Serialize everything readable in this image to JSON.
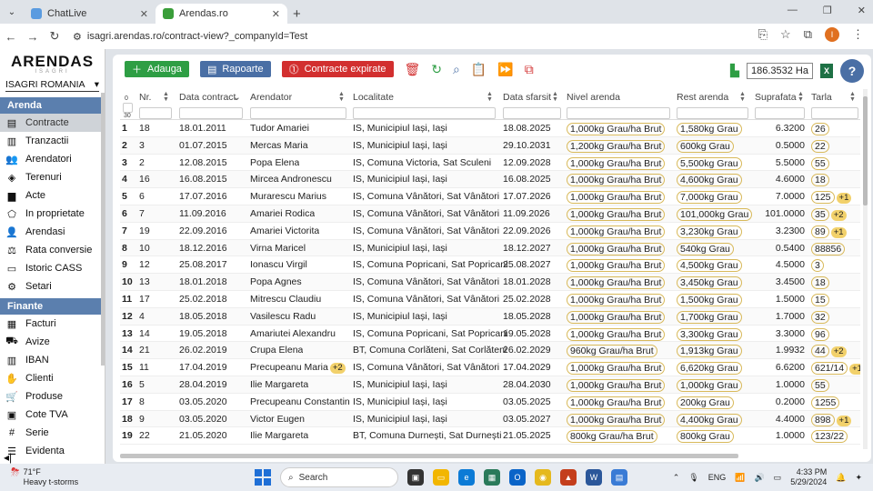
{
  "browser": {
    "tabs": [
      {
        "title": "ChatLive",
        "active": false
      },
      {
        "title": "Arendas.ro",
        "active": true
      }
    ],
    "url": "isagri.arendas.ro/contract-view?_companyId=Test"
  },
  "sidebar": {
    "logo": "ARENDAS",
    "logo_sub": "ISAGRI",
    "company": "ISAGRI ROMANIA",
    "section_arenda": "Arenda",
    "arenda_items": [
      {
        "label": "Contracte",
        "icon": "document-icon"
      },
      {
        "label": "Tranzactii",
        "icon": "book-icon"
      },
      {
        "label": "Arendatori",
        "icon": "people-icon"
      },
      {
        "label": "Terenuri",
        "icon": "layers-icon"
      },
      {
        "label": "Acte",
        "icon": "file-icon"
      },
      {
        "label": "In proprietate",
        "icon": "polygon-icon"
      },
      {
        "label": "Arendasi",
        "icon": "person-icon"
      },
      {
        "label": "Rata conversie",
        "icon": "scale-icon"
      },
      {
        "label": "Istoric CASS",
        "icon": "card-icon"
      },
      {
        "label": "Setari",
        "icon": "gear-icon"
      }
    ],
    "section_finante": "Finante",
    "finante_items": [
      {
        "label": "Facturi",
        "icon": "invoice-icon"
      },
      {
        "label": "Avize",
        "icon": "truck-icon"
      },
      {
        "label": "IBAN",
        "icon": "bank-icon"
      },
      {
        "label": "Clienti",
        "icon": "handshake-icon"
      },
      {
        "label": "Produse",
        "icon": "cart-icon"
      },
      {
        "label": "Cote TVA",
        "icon": "bus-icon"
      },
      {
        "label": "Serie",
        "icon": "hash-icon"
      },
      {
        "label": "Evidenta",
        "icon": "list-icon"
      }
    ]
  },
  "toolbar": {
    "add_label": "Adauga",
    "reports_label": "Rapoarte",
    "expired_label": "Contracte expirate",
    "area_value": "186.3532 Ha"
  },
  "table": {
    "columns": {
      "nr": "Nr.",
      "data_contract": "Data contract",
      "arendator": "Arendator",
      "localitate": "Localitate",
      "data_sfarsit": "Data sfarsit",
      "nivel_arenda": "Nivel arenda",
      "rest_arenda": "Rest arenda",
      "suprafata": "Suprafata",
      "tarla": "Tarla"
    },
    "count_top": "0",
    "count_bottom": "30",
    "rows": [
      {
        "idx": "1",
        "nr": "18",
        "date": "18.01.2011",
        "arendator": "Tudor Amariei",
        "extra_a": "",
        "loc": "IS, Municipiul Iași, Iași",
        "end": "18.08.2025",
        "nivel": "1,000kg Grau/ha Brut",
        "rest": "1,580kg Grau",
        "supr": "6.3200",
        "tarla": "26",
        "extra_t": ""
      },
      {
        "idx": "2",
        "nr": "3",
        "date": "01.07.2015",
        "arendator": "Mercas Maria",
        "extra_a": "",
        "loc": "IS, Municipiul Iași, Iași",
        "end": "29.10.2031",
        "nivel": "1,200kg Grau/ha Brut",
        "rest": "600kg Grau",
        "supr": "0.5000",
        "tarla": "22",
        "extra_t": ""
      },
      {
        "idx": "3",
        "nr": "2",
        "date": "12.08.2015",
        "arendator": "Popa Elena",
        "extra_a": "",
        "loc": "IS, Comuna Victoria, Sat Sculeni",
        "end": "12.09.2028",
        "nivel": "1,000kg Grau/ha Brut",
        "rest": "5,500kg Grau",
        "supr": "5.5000",
        "tarla": "55",
        "extra_t": ""
      },
      {
        "idx": "4",
        "nr": "16",
        "date": "16.08.2015",
        "arendator": "Mircea Andronescu",
        "extra_a": "",
        "loc": "IS, Municipiul Iași, Iași",
        "end": "16.08.2025",
        "nivel": "1,000kg Grau/ha Brut",
        "rest": "4,600kg Grau",
        "supr": "4.6000",
        "tarla": "18",
        "extra_t": ""
      },
      {
        "idx": "5",
        "nr": "6",
        "date": "17.07.2016",
        "arendator": "Murarescu Marius",
        "extra_a": "",
        "loc": "IS, Comuna Vânători, Sat Vânători",
        "end": "17.07.2026",
        "nivel": "1,000kg Grau/ha Brut",
        "rest": "7,000kg Grau",
        "supr": "7.0000",
        "tarla": "125",
        "extra_t": "+1"
      },
      {
        "idx": "6",
        "nr": "7",
        "date": "11.09.2016",
        "arendator": "Amariei Rodica",
        "extra_a": "",
        "loc": "IS, Comuna Vânători, Sat Vânători",
        "end": "11.09.2026",
        "nivel": "1,000kg Grau/ha Brut",
        "rest": "101,000kg Grau",
        "supr": "101.0000",
        "tarla": "35",
        "extra_t": "+2"
      },
      {
        "idx": "7",
        "nr": "19",
        "date": "22.09.2016",
        "arendator": "Amariei Victorita",
        "extra_a": "",
        "loc": "IS, Comuna Vânători, Sat Vânători",
        "end": "22.09.2026",
        "nivel": "1,000kg Grau/ha Brut",
        "rest": "3,230kg Grau",
        "supr": "3.2300",
        "tarla": "89",
        "extra_t": "+1"
      },
      {
        "idx": "8",
        "nr": "10",
        "date": "18.12.2016",
        "arendator": "Virna Maricel",
        "extra_a": "",
        "loc": "IS, Municipiul Iași, Iași",
        "end": "18.12.2027",
        "nivel": "1,000kg Grau/ha Brut",
        "rest": "540kg Grau",
        "supr": "0.5400",
        "tarla": "88856",
        "extra_t": ""
      },
      {
        "idx": "9",
        "nr": "12",
        "date": "25.08.2017",
        "arendator": "Ionascu Virgil",
        "extra_a": "",
        "loc": "IS, Comuna Popricani, Sat Popricani",
        "end": "25.08.2027",
        "nivel": "1,000kg Grau/ha Brut",
        "rest": "4,500kg Grau",
        "supr": "4.5000",
        "tarla": "3",
        "extra_t": ""
      },
      {
        "idx": "10",
        "nr": "13",
        "date": "18.01.2018",
        "arendator": "Popa Agnes",
        "extra_a": "",
        "loc": "IS, Comuna Vânători, Sat Vânători",
        "end": "18.01.2028",
        "nivel": "1,000kg Grau/ha Brut",
        "rest": "3,450kg Grau",
        "supr": "3.4500",
        "tarla": "18",
        "extra_t": ""
      },
      {
        "idx": "11",
        "nr": "17",
        "date": "25.02.2018",
        "arendator": "Mitrescu Claudiu",
        "extra_a": "",
        "loc": "IS, Comuna Vânători, Sat Vânători",
        "end": "25.02.2028",
        "nivel": "1,000kg Grau/ha Brut",
        "rest": "1,500kg Grau",
        "supr": "1.5000",
        "tarla": "15",
        "extra_t": ""
      },
      {
        "idx": "12",
        "nr": "4",
        "date": "18.05.2018",
        "arendator": "Vasilescu Radu",
        "extra_a": "",
        "loc": "IS, Municipiul Iași, Iași",
        "end": "18.05.2028",
        "nivel": "1,000kg Grau/ha Brut",
        "rest": "1,700kg Grau",
        "supr": "1.7000",
        "tarla": "32",
        "extra_t": ""
      },
      {
        "idx": "13",
        "nr": "14",
        "date": "19.05.2018",
        "arendator": "Amariutei Alexandru",
        "extra_a": "",
        "loc": "IS, Comuna Popricani, Sat Popricani",
        "end": "19.05.2028",
        "nivel": "1,000kg Grau/ha Brut",
        "rest": "3,300kg Grau",
        "supr": "3.3000",
        "tarla": "96",
        "extra_t": ""
      },
      {
        "idx": "14",
        "nr": "21",
        "date": "26.02.2019",
        "arendator": "Crupa Elena",
        "extra_a": "",
        "loc": "BT, Comuna Corlăteni, Sat Corlăteni",
        "end": "26.02.2029",
        "nivel": "960kg Grau/ha Brut",
        "rest": "1,913kg Grau",
        "supr": "1.9932",
        "tarla": "44",
        "extra_t": "+2"
      },
      {
        "idx": "15",
        "nr": "11",
        "date": "17.04.2019",
        "arendator": "Precupeanu Maria",
        "extra_a": "+2",
        "loc": "IS, Comuna Vânători, Sat Vânători",
        "end": "17.04.2029",
        "nivel": "1,000kg Grau/ha Brut",
        "rest": "6,620kg Grau",
        "supr": "6.6200",
        "tarla": "621/14",
        "extra_t": "+1"
      },
      {
        "idx": "16",
        "nr": "5",
        "date": "28.04.2019",
        "arendator": "Ilie Margareta",
        "extra_a": "",
        "loc": "IS, Municipiul Iași, Iași",
        "end": "28.04.2030",
        "nivel": "1,000kg Grau/ha Brut",
        "rest": "1,000kg Grau",
        "supr": "1.0000",
        "tarla": "55",
        "extra_t": ""
      },
      {
        "idx": "17",
        "nr": "8",
        "date": "03.05.2020",
        "arendator": "Precupeanu Constantin",
        "extra_a": "",
        "loc": "IS, Municipiul Iași, Iași",
        "end": "03.05.2025",
        "nivel": "1,000kg Grau/ha Brut",
        "rest": "200kg Grau",
        "supr": "0.2000",
        "tarla": "1255",
        "extra_t": ""
      },
      {
        "idx": "18",
        "nr": "9",
        "date": "03.05.2020",
        "arendator": "Victor Eugen",
        "extra_a": "",
        "loc": "IS, Municipiul Iași, Iași",
        "end": "03.05.2027",
        "nivel": "1,000kg Grau/ha Brut",
        "rest": "4,400kg Grau",
        "supr": "4.4000",
        "tarla": "898",
        "extra_t": "+1"
      },
      {
        "idx": "19",
        "nr": "22",
        "date": "21.05.2020",
        "arendator": "Ilie Margareta",
        "extra_a": "",
        "loc": "BT, Comuna Durnești, Sat Durnești",
        "end": "21.05.2025",
        "nivel": "800kg Grau/ha Brut",
        "rest": "800kg Grau",
        "supr": "1.0000",
        "tarla": "123/22",
        "extra_t": ""
      }
    ]
  },
  "taskbar": {
    "temp": "71°F",
    "weather": "Heavy t-storms",
    "search_placeholder": "Search",
    "lang": "ENG",
    "time": "4:33 PM",
    "date": "5/29/2024"
  }
}
